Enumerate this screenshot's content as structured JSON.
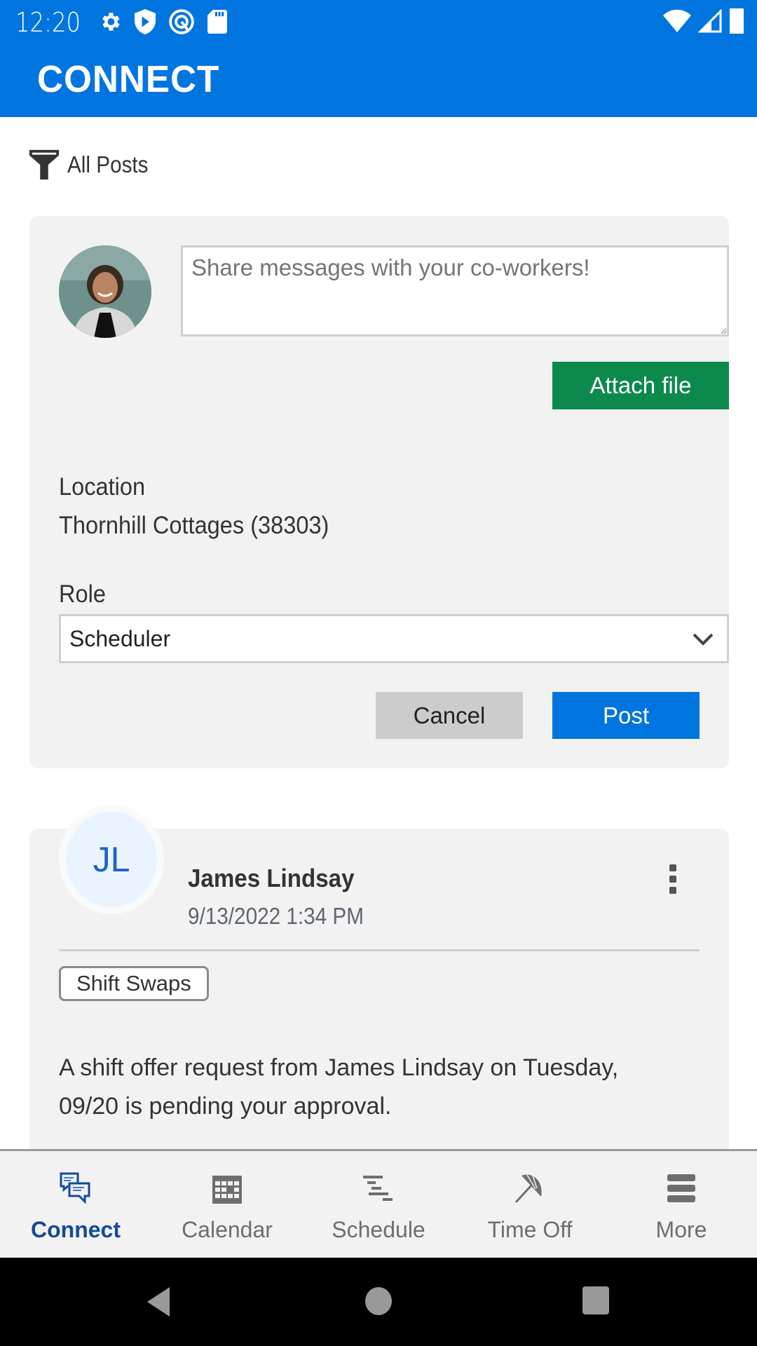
{
  "status_bar": {
    "time": "12:20",
    "left_icons": [
      "settings-icon",
      "shield-play-icon",
      "vpn-icon",
      "sd-card-icon"
    ],
    "right_icons": [
      "wifi-icon",
      "cell-signal-icon",
      "battery-icon"
    ]
  },
  "header": {
    "title": "CONNECT"
  },
  "filter": {
    "label": "All Posts",
    "icon": "filter-icon"
  },
  "composer": {
    "placeholder": "Share messages with your co-workers!",
    "value": "",
    "attach_label": "Attach file",
    "location_label": "Location",
    "location_value": "Thornhill Cottages (38303)",
    "role_label": "Role",
    "role_selected": "Scheduler",
    "cancel_label": "Cancel",
    "post_label": "Post"
  },
  "posts": [
    {
      "initials": "JL",
      "author": "James Lindsay",
      "timestamp": "9/13/2022 1:34 PM",
      "tag": "Shift Swaps",
      "body": "A shift offer request from James Lindsay on Tuesday, 09/20 is pending your approval."
    }
  ],
  "bottom_nav": {
    "items": [
      {
        "label": "Connect",
        "icon": "chat-bubbles-icon",
        "active": true
      },
      {
        "label": "Calendar",
        "icon": "calendar-icon",
        "active": false
      },
      {
        "label": "Schedule",
        "icon": "schedule-icon",
        "active": false
      },
      {
        "label": "Time Off",
        "icon": "umbrella-icon",
        "active": false
      },
      {
        "label": "More",
        "icon": "menu-icon",
        "active": false
      }
    ]
  },
  "colors": {
    "brand_blue": "#0075e0",
    "attach_green": "#0c8a4c",
    "active_nav": "#134a9a"
  }
}
